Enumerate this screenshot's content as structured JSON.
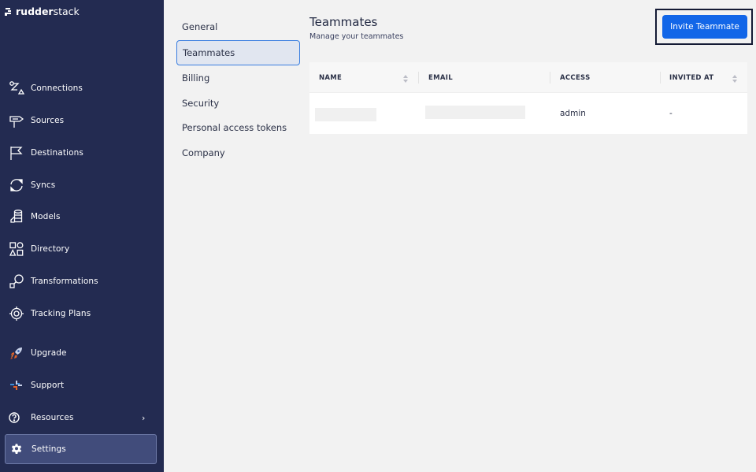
{
  "brand": {
    "name_bold": "rudder",
    "name_light": "stack"
  },
  "sidebar": {
    "items": [
      {
        "label": "Connections",
        "icon": "connections-icon"
      },
      {
        "label": "Sources",
        "icon": "signpost-icon"
      },
      {
        "label": "Destinations",
        "icon": "flag-icon"
      },
      {
        "label": "Syncs",
        "icon": "sync-icon"
      },
      {
        "label": "Models",
        "icon": "models-icon"
      },
      {
        "label": "Directory",
        "icon": "shapes-icon"
      },
      {
        "label": "Transformations",
        "icon": "transform-icon"
      },
      {
        "label": "Tracking Plans",
        "icon": "target-icon"
      },
      {
        "label": "Upgrade",
        "icon": "rocket-icon"
      },
      {
        "label": "Support",
        "icon": "slack-icon"
      },
      {
        "label": "Resources",
        "icon": "question-icon",
        "chevron": "›"
      },
      {
        "label": "Settings",
        "icon": "gear-icon",
        "active": true
      }
    ]
  },
  "settings_menu": {
    "items": [
      {
        "label": "General"
      },
      {
        "label": "Teammates",
        "active": true
      },
      {
        "label": "Billing"
      },
      {
        "label": "Security"
      },
      {
        "label": "Personal access tokens"
      },
      {
        "label": "Company"
      }
    ]
  },
  "main": {
    "title": "Teammates",
    "subtitle": "Manage your teammates",
    "invite_button": "Invite Teammate",
    "table": {
      "columns": [
        "NAME",
        "EMAIL",
        "ACCESS",
        "INVITED AT"
      ],
      "rows": [
        {
          "name": "",
          "email": "",
          "access": "admin",
          "invited_at": "-"
        }
      ]
    }
  },
  "colors": {
    "sidebar_bg": "#232b51",
    "accent": "#1266e8",
    "active_nav": "#414c7b"
  }
}
